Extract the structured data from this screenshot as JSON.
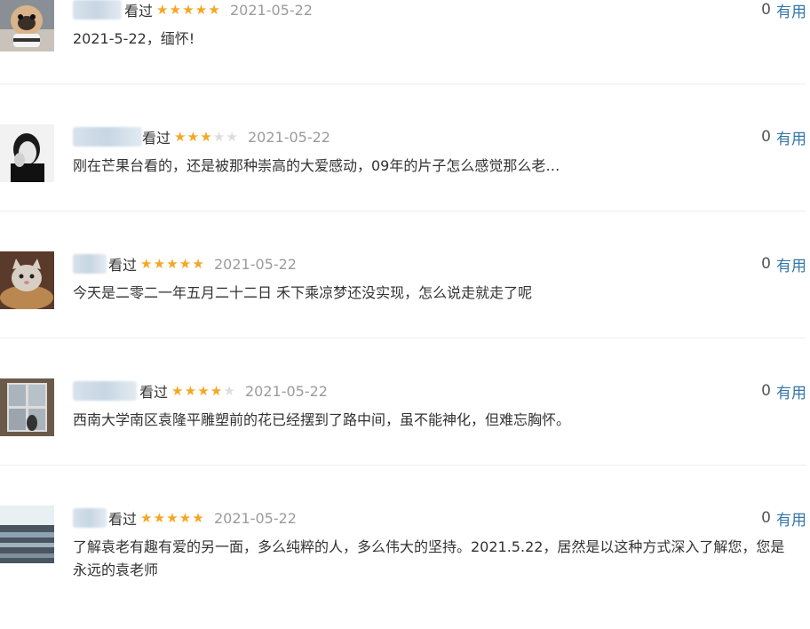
{
  "comments": [
    {
      "watched_label": "看过",
      "rating": 5,
      "date": "2021-05-22",
      "votes": "0",
      "useful_label": "有用",
      "content": "2021-5-22，缅怀!",
      "avatar_icon": "pug-dog-avatar"
    },
    {
      "watched_label": "看过",
      "rating": 3,
      "date": "2021-05-22",
      "votes": "0",
      "useful_label": "有用",
      "content": "刚在芒果台看的，还是被那种崇高的大爱感动，09年的片子怎么感觉那么老…",
      "avatar_icon": "man-portrait-avatar"
    },
    {
      "watched_label": "看过",
      "rating": 5,
      "date": "2021-05-22",
      "votes": "0",
      "useful_label": "有用",
      "content": "今天是二零二一年五月二十二日 禾下乘凉梦还没实现，怎么说走就走了呢",
      "avatar_icon": "cat-avatar"
    },
    {
      "watched_label": "看过",
      "rating": 4,
      "date": "2021-05-22",
      "votes": "0",
      "useful_label": "有用",
      "content": "西南大学南区袁隆平雕塑前的花已经摆到了路中间，虽不能神化，但难忘胸怀。",
      "avatar_icon": "window-avatar"
    },
    {
      "watched_label": "看过",
      "rating": 5,
      "date": "2021-05-22",
      "votes": "0",
      "useful_label": "有用",
      "content": "了解袁老有趣有爱的另一面，多么纯粹的人，多么伟大的坚持。2021.5.22，居然是以这种方式深入了解您，您是永远的袁老师",
      "avatar_icon": "landscape-avatar"
    }
  ],
  "colors": {
    "star_on": "#f5a623",
    "star_off": "#dddddd",
    "link": "#3377aa",
    "date": "#9b9b9b",
    "divider": "#eeeeee"
  }
}
